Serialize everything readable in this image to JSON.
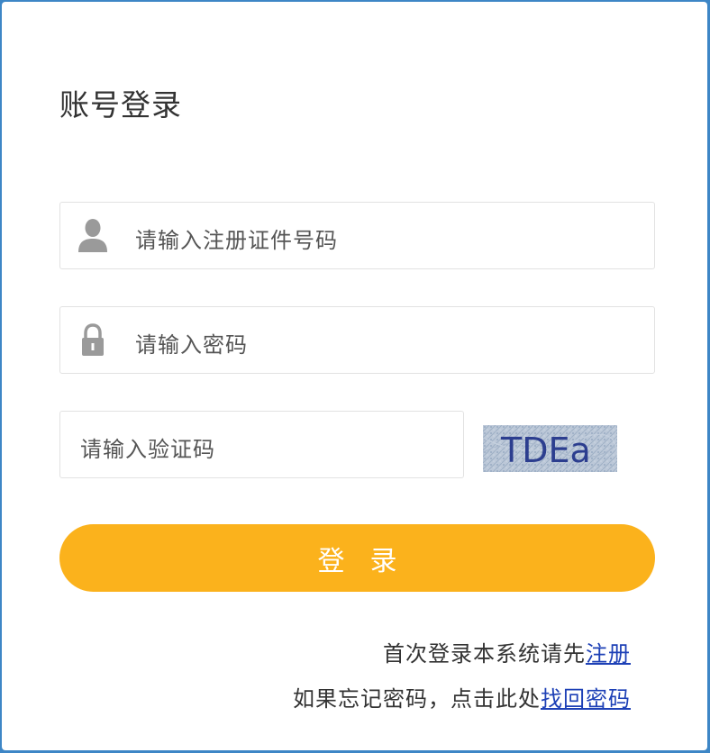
{
  "login": {
    "title": "账号登录",
    "username_placeholder": "请输入注册证件号码",
    "password_placeholder": "请输入密码",
    "captcha_placeholder": "请输入验证码",
    "captcha_text": "TDEa",
    "submit_label": "登录"
  },
  "help": {
    "register_prefix": "首次登录本系统请先",
    "register_link": "注册",
    "forgot_prefix": "如果忘记密码，点击此处",
    "forgot_link": "找回密码"
  },
  "icons": {
    "username": "user-icon",
    "password": "lock-icon"
  },
  "colors": {
    "submit": "#fbb21c",
    "link": "#1d40b6"
  }
}
